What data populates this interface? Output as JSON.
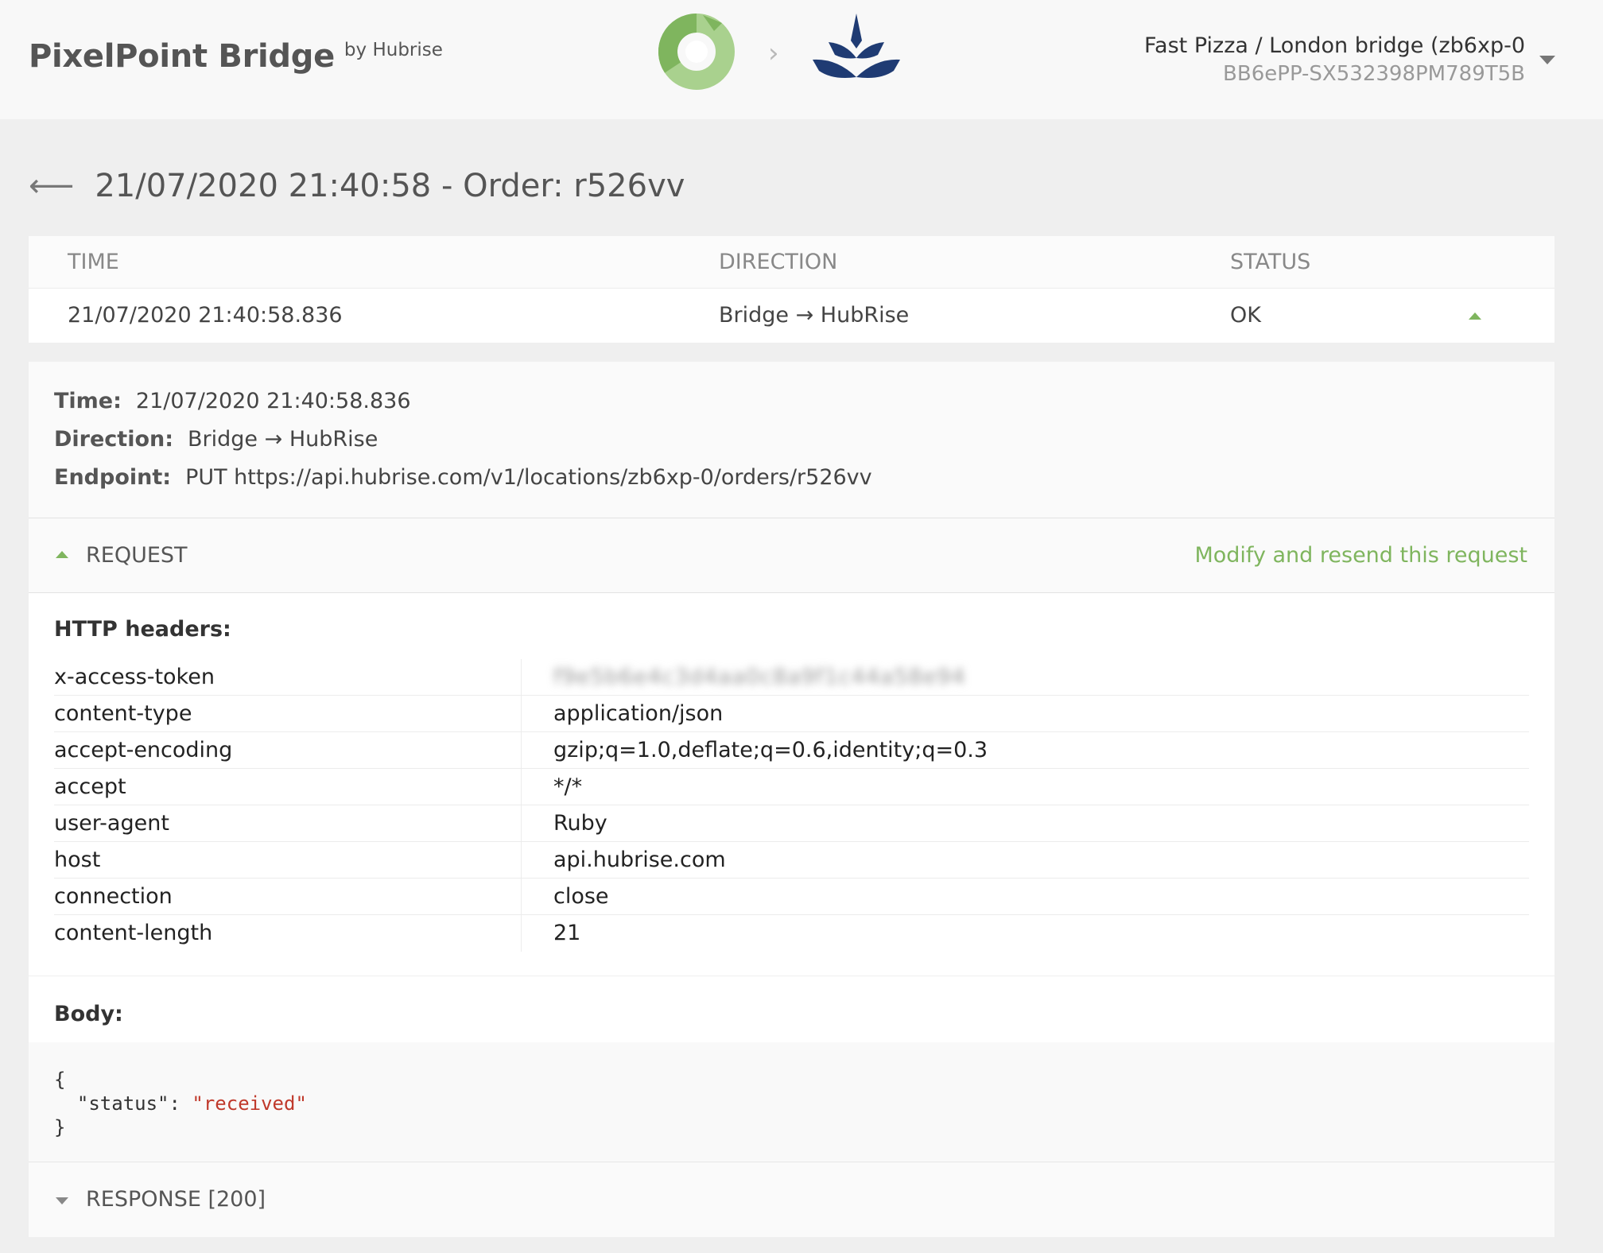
{
  "header": {
    "app_name": "PixelPoint Bridge",
    "by_label": "by Hubrise",
    "arrow": "›",
    "account_name": "Fast Pizza / London bridge (zb6xp-0",
    "account_id": "BB6ePP-SX532398PM789T5B",
    "colors": {
      "source_logo": "#7fb55e",
      "target_logo": "#1f3b73"
    }
  },
  "page": {
    "back_icon": "arrow-left-icon",
    "title": "21/07/2020 21:40:58 - Order: r526vv"
  },
  "log_table": {
    "columns": [
      "TIME",
      "DIRECTION",
      "STATUS"
    ],
    "row": {
      "time": "21/07/2020 21:40:58.836",
      "direction": "Bridge → HubRise",
      "status": "OK"
    }
  },
  "summary": {
    "time_label": "Time:",
    "time_value": "21/07/2020 21:40:58.836",
    "direction_label": "Direction:",
    "direction_value": "Bridge → HubRise",
    "endpoint_label": "Endpoint:",
    "endpoint_value": "PUT https://api.hubrise.com/v1/locations/zb6xp-0/orders/r526vv"
  },
  "request": {
    "label": "REQUEST",
    "resend_link": "Modify and resend this request",
    "headers_title": "HTTP headers:",
    "headers": [
      {
        "key": "x-access-token",
        "value": "f9e5b6e4c3d4aa0c8a9f1c44a58e94"
      },
      {
        "key": "content-type",
        "value": "application/json"
      },
      {
        "key": "accept-encoding",
        "value": "gzip;q=1.0,deflate;q=0.6,identity;q=0.3"
      },
      {
        "key": "accept",
        "value": "*/*"
      },
      {
        "key": "user-agent",
        "value": "Ruby"
      },
      {
        "key": "host",
        "value": "api.hubrise.com"
      },
      {
        "key": "connection",
        "value": "close"
      },
      {
        "key": "content-length",
        "value": "21"
      }
    ],
    "body_title": "Body:",
    "body": {
      "open": "{",
      "key": "\"status\"",
      "colon": ": ",
      "value": "\"received\"",
      "close": "}"
    }
  },
  "response": {
    "label": "RESPONSE [200]"
  }
}
